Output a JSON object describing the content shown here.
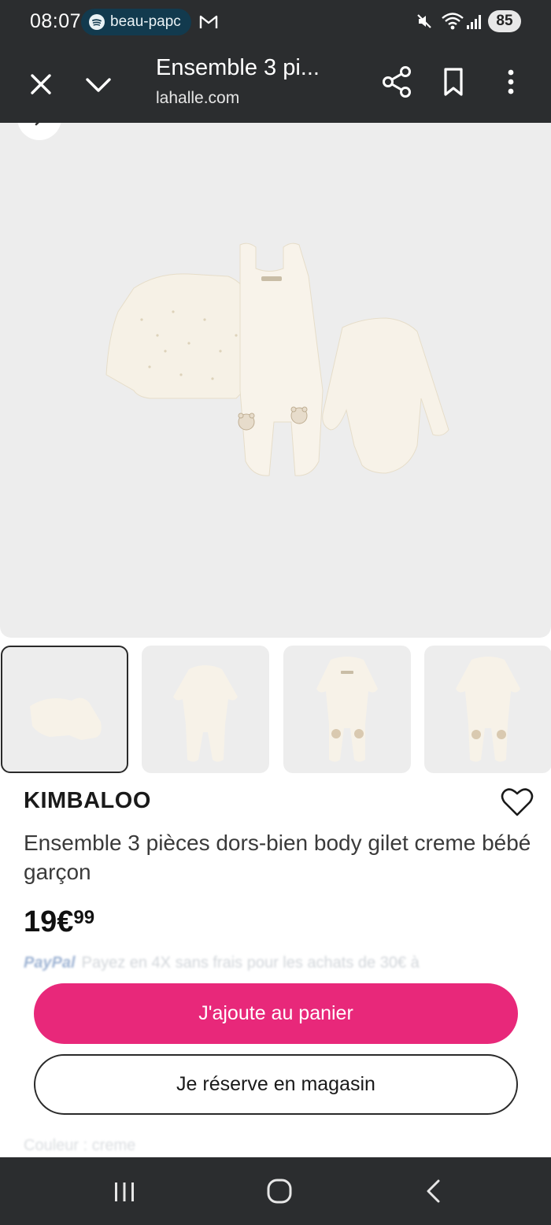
{
  "status_bar": {
    "time": "08:07",
    "spotify_label": "beau-papc",
    "battery": "85",
    "icons": [
      "spotify-icon",
      "gmail-icon",
      "mute-icon",
      "wifi-icon",
      "signal-icon",
      "battery-icon"
    ]
  },
  "browser": {
    "title": "Ensemble 3 pi...",
    "url": "lahalle.com",
    "icons": [
      "close-icon",
      "chevron-down-icon",
      "share-icon",
      "bookmark-icon",
      "more-vert-icon"
    ]
  },
  "product": {
    "brand": "KIMBALOO",
    "name": "Ensemble 3 pièces dors-bien body gilet creme bébé garçon",
    "price_main": "19€",
    "price_cents": "99",
    "thumbnail_count": 4
  },
  "paypal": {
    "logo": "PayPal",
    "text": "Payez en 4X sans frais pour les achats de 30€ à"
  },
  "actions": {
    "add_to_cart": "J'ajoute au panier",
    "reserve_in_store": "Je réserve en magasin"
  },
  "below_fold": {
    "text": "Couleur : creme"
  },
  "colors": {
    "accent": "#e8287a",
    "bars": "#2b2d2f",
    "image_bg": "#ededed"
  }
}
